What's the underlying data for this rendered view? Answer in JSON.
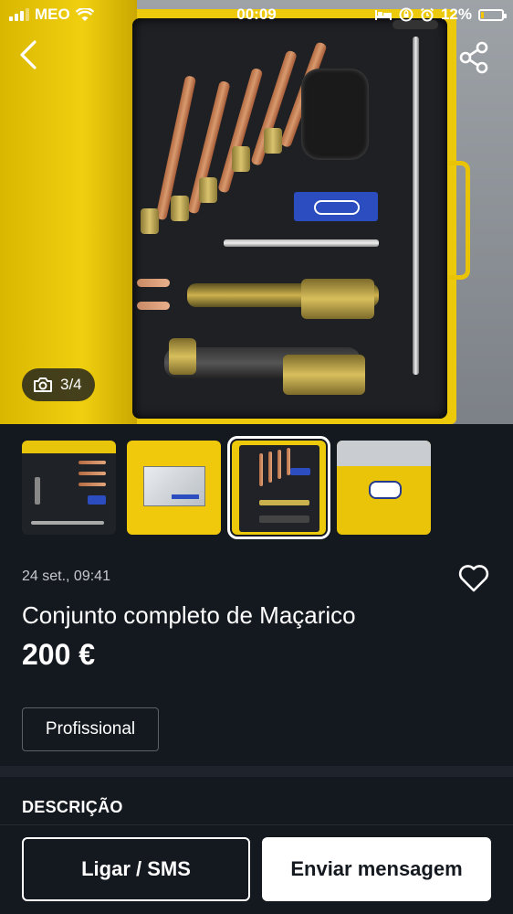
{
  "status_bar": {
    "carrier": "MEO",
    "time": "00:09",
    "battery": "12%",
    "battery_level": 0.12,
    "icons": [
      "signal-icon",
      "wifi-icon",
      "bed-icon",
      "lock-rotation-icon",
      "alarm-icon",
      "battery-icon"
    ]
  },
  "gallery": {
    "counter": "3/4",
    "current_index": 3,
    "total": 4,
    "icons": [
      "back-arrow-icon",
      "share-icon",
      "camera-icon"
    ]
  },
  "listing": {
    "date": "24 set., 09:41",
    "title": "Conjunto completo de Maçarico",
    "price": "200 €",
    "tag": "Profissional"
  },
  "description": {
    "heading": "DESCRIÇÃO"
  },
  "actions": {
    "call_label": "Ligar / SMS",
    "message_label": "Enviar mensagem"
  },
  "colors": {
    "background": "#14181f",
    "case_yellow": "#ecc90a",
    "battery_fill": "#f4c400",
    "primary_button": "#ffffff"
  }
}
